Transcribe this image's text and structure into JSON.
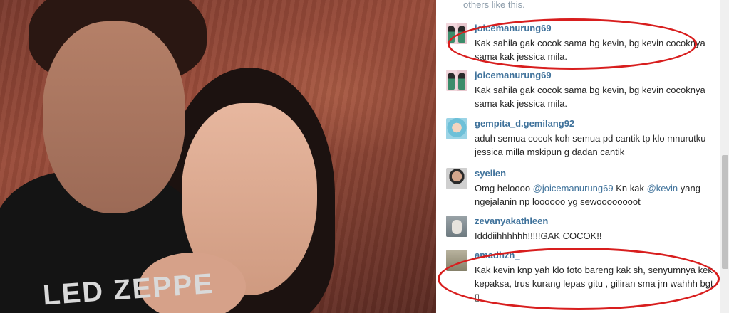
{
  "photo": {
    "shirt_text": "LED ZEPPE"
  },
  "likes_line": "others like this.",
  "comments": [
    {
      "username": "joicemanurung69",
      "avatar_icon": "user-avatar-icon",
      "parts": [
        {
          "type": "text",
          "value": "Kak sahila gak cocok sama bg kevin, bg kevin cocoknya sama kak jessica mila."
        }
      ]
    },
    {
      "username": "joicemanurung69",
      "avatar_icon": "user-avatar-icon",
      "parts": [
        {
          "type": "text",
          "value": "Kak sahila gak cocok sama bg kevin, bg kevin cocoknya sama kak jessica mila."
        }
      ]
    },
    {
      "username": "gempita_d.gemilang92",
      "avatar_icon": "user-avatar-icon",
      "parts": [
        {
          "type": "text",
          "value": "aduh semua cocok koh semua pd cantik tp klo mnurutku jessica milla mskipun g dadan cantik"
        }
      ]
    },
    {
      "username": "syelien",
      "avatar_icon": "user-avatar-icon",
      "parts": [
        {
          "type": "text",
          "value": "Omg heloooo "
        },
        {
          "type": "mention",
          "value": "@joicemanurung69"
        },
        {
          "type": "text",
          "value": " Kn kak "
        },
        {
          "type": "mention",
          "value": "@kevin"
        },
        {
          "type": "text",
          "value": " yang ngejalanin np loooooo yg sewoooooooot"
        }
      ]
    },
    {
      "username": "zevanyakathleen",
      "avatar_icon": "user-avatar-icon",
      "parts": [
        {
          "type": "text",
          "value": "Idddiihhhhhh!!!!!GAK COCOK!!"
        }
      ]
    },
    {
      "username": "amadhzn_",
      "avatar_icon": "user-avatar-icon",
      "parts": [
        {
          "type": "text",
          "value": "Kak kevin knp yah klo foto bareng kak sh, senyumnya kek kepaksa, trus kurang lepas gitu , giliran sma jm wahhh bgt "
        },
        {
          "type": "text",
          "value": "▯"
        }
      ]
    }
  ],
  "annotation_color": "#d81e1e",
  "username_color": "#3f729b"
}
